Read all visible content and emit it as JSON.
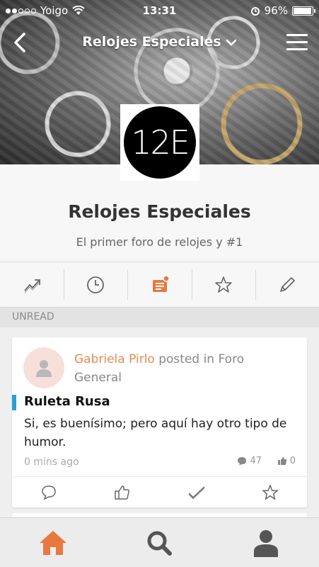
{
  "status_bar": {
    "carrier": "Yoigo",
    "time": "13:31",
    "battery": "96%",
    "battery_level": 0.96
  },
  "nav": {
    "title": "Relojes Especiales"
  },
  "forum": {
    "logo_text": "12E",
    "name": "Relojes Especiales",
    "description": "El primer foro de relojes y #1"
  },
  "tabs": [
    {
      "icon": "trending-icon"
    },
    {
      "icon": "clock-icon"
    },
    {
      "icon": "unread-icon",
      "active": true
    },
    {
      "icon": "star-icon"
    },
    {
      "icon": "pencil-icon"
    }
  ],
  "section": {
    "label": "UNREAD"
  },
  "post": {
    "author": "Gabriela Pirlo",
    "posted_in_text": "posted in",
    "forum_name": "Foro General",
    "title": "Ruleta Rusa",
    "body": "Si, es buenísimo; pero aquí hay otro tipo de humor.",
    "time": "0 mins ago",
    "comments": "47",
    "likes": "0"
  },
  "colors": {
    "accent": "#e8783f",
    "author": "#e98a52",
    "title_bar": "#2a9fd7"
  }
}
